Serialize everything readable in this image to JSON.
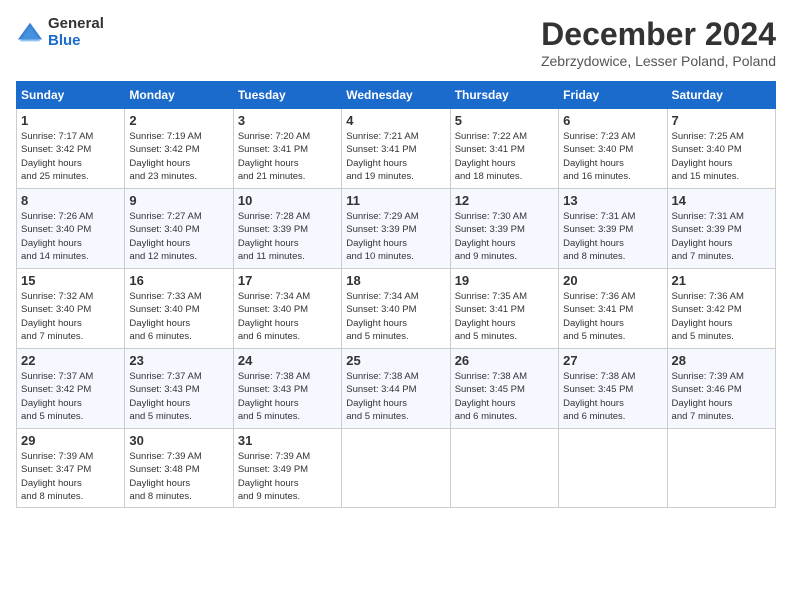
{
  "logo": {
    "general": "General",
    "blue": "Blue"
  },
  "title": {
    "month": "December 2024",
    "location": "Zebrzydowice, Lesser Poland, Poland"
  },
  "headers": [
    "Sunday",
    "Monday",
    "Tuesday",
    "Wednesday",
    "Thursday",
    "Friday",
    "Saturday"
  ],
  "weeks": [
    [
      {
        "day": "1",
        "sunrise": "7:17 AM",
        "sunset": "3:42 PM",
        "daylight": "8 hours and 25 minutes."
      },
      {
        "day": "2",
        "sunrise": "7:19 AM",
        "sunset": "3:42 PM",
        "daylight": "8 hours and 23 minutes."
      },
      {
        "day": "3",
        "sunrise": "7:20 AM",
        "sunset": "3:41 PM",
        "daylight": "8 hours and 21 minutes."
      },
      {
        "day": "4",
        "sunrise": "7:21 AM",
        "sunset": "3:41 PM",
        "daylight": "8 hours and 19 minutes."
      },
      {
        "day": "5",
        "sunrise": "7:22 AM",
        "sunset": "3:41 PM",
        "daylight": "8 hours and 18 minutes."
      },
      {
        "day": "6",
        "sunrise": "7:23 AM",
        "sunset": "3:40 PM",
        "daylight": "8 hours and 16 minutes."
      },
      {
        "day": "7",
        "sunrise": "7:25 AM",
        "sunset": "3:40 PM",
        "daylight": "8 hours and 15 minutes."
      }
    ],
    [
      {
        "day": "8",
        "sunrise": "7:26 AM",
        "sunset": "3:40 PM",
        "daylight": "8 hours and 14 minutes."
      },
      {
        "day": "9",
        "sunrise": "7:27 AM",
        "sunset": "3:40 PM",
        "daylight": "8 hours and 12 minutes."
      },
      {
        "day": "10",
        "sunrise": "7:28 AM",
        "sunset": "3:39 PM",
        "daylight": "8 hours and 11 minutes."
      },
      {
        "day": "11",
        "sunrise": "7:29 AM",
        "sunset": "3:39 PM",
        "daylight": "8 hours and 10 minutes."
      },
      {
        "day": "12",
        "sunrise": "7:30 AM",
        "sunset": "3:39 PM",
        "daylight": "8 hours and 9 minutes."
      },
      {
        "day": "13",
        "sunrise": "7:31 AM",
        "sunset": "3:39 PM",
        "daylight": "8 hours and 8 minutes."
      },
      {
        "day": "14",
        "sunrise": "7:31 AM",
        "sunset": "3:39 PM",
        "daylight": "8 hours and 7 minutes."
      }
    ],
    [
      {
        "day": "15",
        "sunrise": "7:32 AM",
        "sunset": "3:40 PM",
        "daylight": "8 hours and 7 minutes."
      },
      {
        "day": "16",
        "sunrise": "7:33 AM",
        "sunset": "3:40 PM",
        "daylight": "8 hours and 6 minutes."
      },
      {
        "day": "17",
        "sunrise": "7:34 AM",
        "sunset": "3:40 PM",
        "daylight": "8 hours and 6 minutes."
      },
      {
        "day": "18",
        "sunrise": "7:34 AM",
        "sunset": "3:40 PM",
        "daylight": "8 hours and 5 minutes."
      },
      {
        "day": "19",
        "sunrise": "7:35 AM",
        "sunset": "3:41 PM",
        "daylight": "8 hours and 5 minutes."
      },
      {
        "day": "20",
        "sunrise": "7:36 AM",
        "sunset": "3:41 PM",
        "daylight": "8 hours and 5 minutes."
      },
      {
        "day": "21",
        "sunrise": "7:36 AM",
        "sunset": "3:42 PM",
        "daylight": "8 hours and 5 minutes."
      }
    ],
    [
      {
        "day": "22",
        "sunrise": "7:37 AM",
        "sunset": "3:42 PM",
        "daylight": "8 hours and 5 minutes."
      },
      {
        "day": "23",
        "sunrise": "7:37 AM",
        "sunset": "3:43 PM",
        "daylight": "8 hours and 5 minutes."
      },
      {
        "day": "24",
        "sunrise": "7:38 AM",
        "sunset": "3:43 PM",
        "daylight": "8 hours and 5 minutes."
      },
      {
        "day": "25",
        "sunrise": "7:38 AM",
        "sunset": "3:44 PM",
        "daylight": "8 hours and 5 minutes."
      },
      {
        "day": "26",
        "sunrise": "7:38 AM",
        "sunset": "3:45 PM",
        "daylight": "8 hours and 6 minutes."
      },
      {
        "day": "27",
        "sunrise": "7:38 AM",
        "sunset": "3:45 PM",
        "daylight": "8 hours and 6 minutes."
      },
      {
        "day": "28",
        "sunrise": "7:39 AM",
        "sunset": "3:46 PM",
        "daylight": "8 hours and 7 minutes."
      }
    ],
    [
      {
        "day": "29",
        "sunrise": "7:39 AM",
        "sunset": "3:47 PM",
        "daylight": "8 hours and 8 minutes."
      },
      {
        "day": "30",
        "sunrise": "7:39 AM",
        "sunset": "3:48 PM",
        "daylight": "8 hours and 8 minutes."
      },
      {
        "day": "31",
        "sunrise": "7:39 AM",
        "sunset": "3:49 PM",
        "daylight": "8 hours and 9 minutes."
      },
      null,
      null,
      null,
      null
    ]
  ]
}
